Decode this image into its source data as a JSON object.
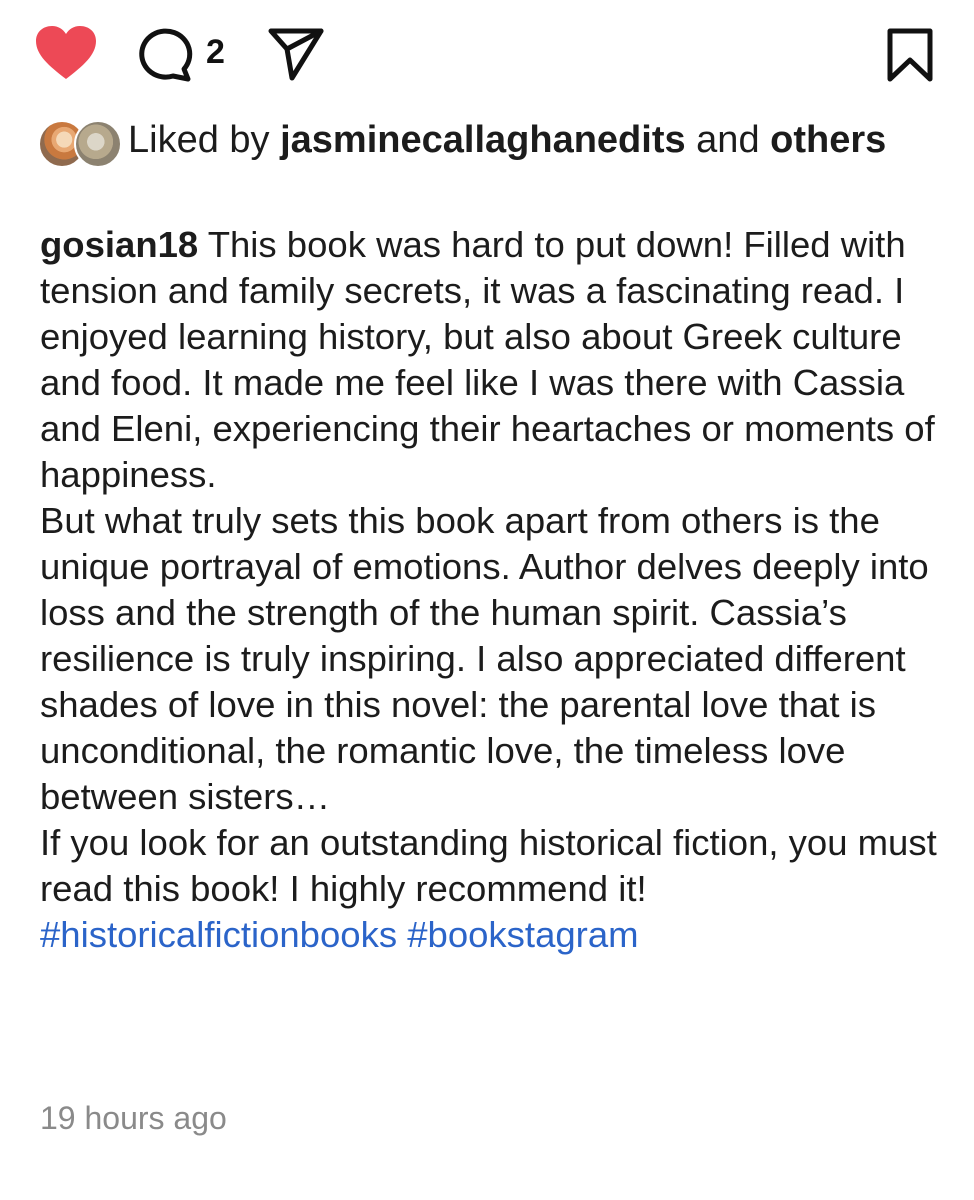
{
  "actions": {
    "comment_count": "2",
    "like_color": "#ed4956",
    "icons": [
      "heart-icon",
      "comment-icon",
      "share-icon",
      "bookmark-icon"
    ]
  },
  "likes": {
    "prefix": "Liked by",
    "user": "jasminecallaghanedits",
    "conjunction": "and",
    "others": "others"
  },
  "caption": {
    "username": "gosian18",
    "paragraph1": " This book was hard to put down! Filled with tension and family secrets, it was a fascinating read. I enjoyed learning history, but also about Greek culture and food. It made me feel like I was there with Cassia and Eleni, experiencing their heartaches or moments of happiness.",
    "paragraph2": "But what truly sets this book apart from others is the unique portrayal of emotions. Author delves deeply into loss and the strength of the human spirit. Cassia’s resilience is truly inspiring. I also appreciated different shades of love in this novel: the parental love that is unconditional, the romantic love, the timeless love between sisters…",
    "paragraph3": "If you look for an outstanding historical fiction, you must read this book! I highly recommend it! ",
    "hashtags": [
      "#historicalfictionbooks",
      "#bookstagram"
    ],
    "hashtag_color": "#2b64c9"
  },
  "timestamp": "19 hours ago"
}
